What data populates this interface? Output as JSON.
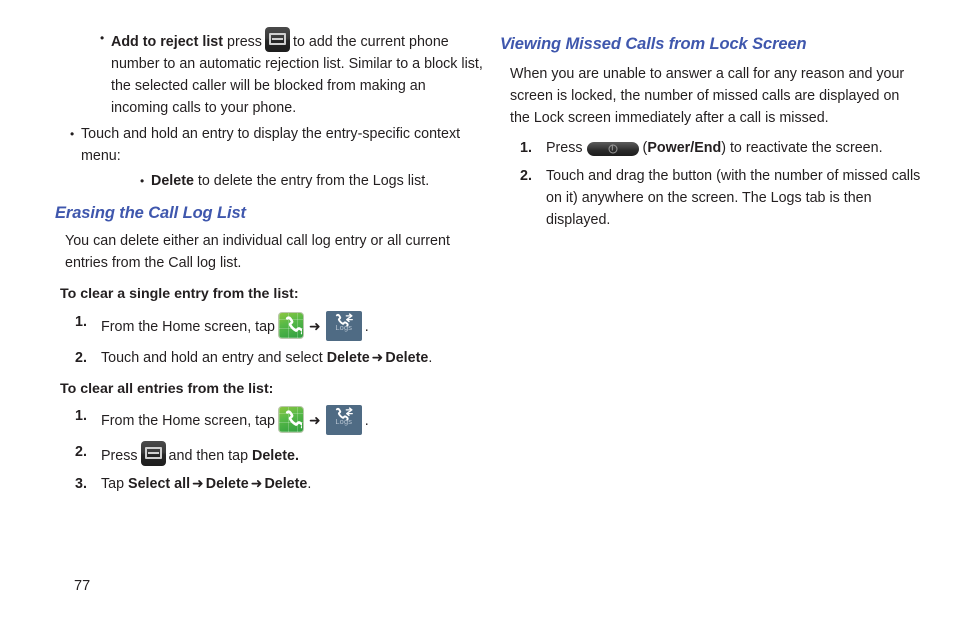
{
  "document": {
    "page_number": "77",
    "heading_color": "#3f57ad",
    "body_color": "#231f20"
  },
  "left_column": {
    "bullet_add_to_reject": {
      "term": "Add to reject list",
      "text_before_icon": "press",
      "icon": "menu-key-icon",
      "text_after_icon": "to add the current phone number to an automatic rejection list. Similar to a block list, the selected caller will be blocked from making an incoming calls to your phone."
    },
    "bullet_touch_and_hold": {
      "text": "Touch and hold an entry to display the entry-specific context menu:"
    },
    "bullet_delete": {
      "term": "Delete",
      "text": "to delete the entry from the Logs list."
    },
    "section_heading": "Erasing the Call Log List",
    "intro_paragraph": "You can delete either an individual call log entry or all current entries from the Call log list.",
    "subheading_single": "To clear a single entry from the list:",
    "steps_single": [
      {
        "number": "1.",
        "text_before": "From the Home screen, tap",
        "icon_1": "phone-icon",
        "arrow": "➜",
        "icon_2": "logs-icon",
        "text_after": "."
      },
      {
        "number": "2.",
        "text_before": "Touch and hold an entry and select",
        "bold_1": "Delete",
        "arrow": "➜",
        "bold_2": "Delete",
        "text_after": "."
      }
    ],
    "subheading_all": "To clear all entries from the list:",
    "steps_all": [
      {
        "number": "1.",
        "text_before": "From the Home screen, tap",
        "icon_1": "phone-icon",
        "arrow": "➜",
        "icon_2": "logs-icon",
        "text_after": "."
      },
      {
        "number": "2.",
        "text_before": "Press",
        "icon": "menu-key-icon",
        "text_mid": "and then tap",
        "bold_1": "Delete.",
        "text_after": ""
      },
      {
        "number": "3.",
        "text_before": "Tap",
        "bold_1": "Select all",
        "arrow_1": "➜",
        "bold_2": "Delete",
        "arrow_2": "➜",
        "bold_3": "Delete",
        "text_after": "."
      }
    ]
  },
  "right_column": {
    "section_heading": "Viewing Missed Calls from Lock Screen",
    "intro_paragraph": "When you are unable to answer a call for any reason and your screen is locked, the number of missed calls are displayed on the Lock screen immediately after a call is missed.",
    "steps": [
      {
        "number": "1.",
        "text_before": "Press",
        "icon": "power-end-button-icon",
        "paren_open": "(",
        "bold_1": "Power/End",
        "paren_close": ")",
        "text_after": "to reactivate the screen."
      },
      {
        "number": "2.",
        "text": "Touch and drag the button (with the number of missed calls on it) anywhere on the screen. The Logs tab is then displayed."
      }
    ]
  },
  "icons": {
    "menu_key": "menu-key-icon",
    "phone": "phone-icon",
    "logs": "logs-icon",
    "logs_label": "Logs",
    "power_end": "power-end-button-icon"
  }
}
